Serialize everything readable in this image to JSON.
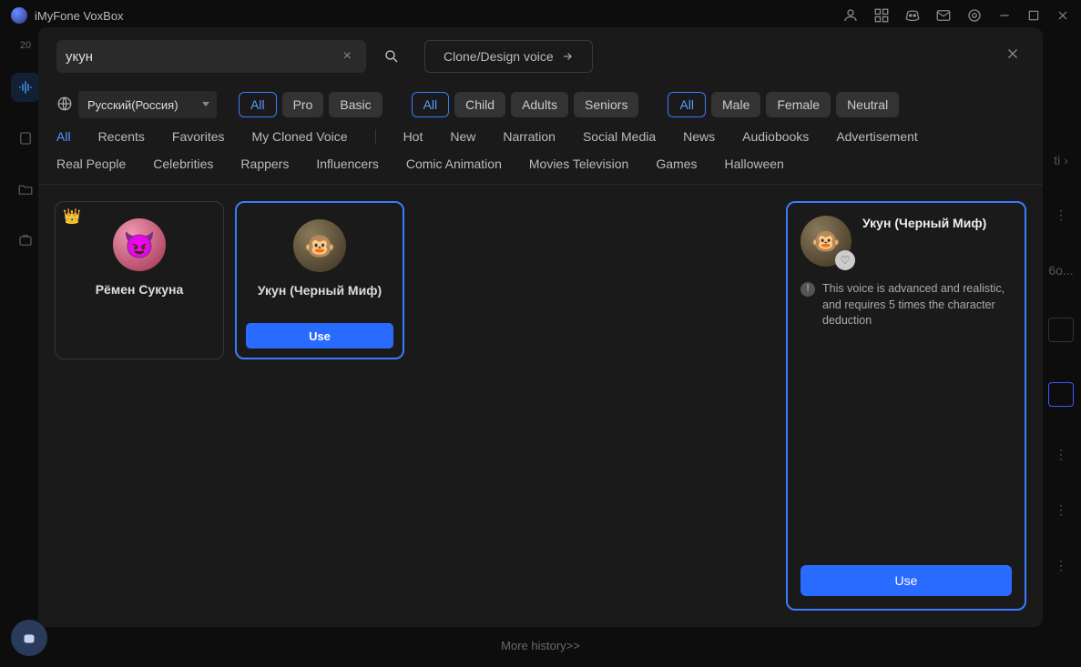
{
  "title": "iMyFone VoxBox",
  "backdrop": {
    "more_history": "More history>>",
    "rightpeek": [
      "ti ›",
      "6o...",
      "⋮",
      "⋮",
      "⋮"
    ]
  },
  "search": {
    "value": "укун",
    "clear": "×"
  },
  "clone_label": "Clone/Design voice",
  "lang": {
    "selected": "Русский(Россия)"
  },
  "filters": {
    "tier": {
      "all": "All",
      "pro": "Pro",
      "basic": "Basic"
    },
    "age": {
      "all": "All",
      "child": "Child",
      "adults": "Adults",
      "seniors": "Seniors"
    },
    "gender": {
      "all": "All",
      "male": "Male",
      "female": "Female",
      "neutral": "Neutral"
    }
  },
  "cats1": {
    "all": "All",
    "recents": "Recents",
    "favorites": "Favorites",
    "my_cloned": "My Cloned Voice",
    "hot": "Hot",
    "new": "New",
    "narration": "Narration",
    "social": "Social Media",
    "news": "News",
    "audiobooks": "Audiobooks",
    "advertisement": "Advertisement"
  },
  "cats2": {
    "real": "Real People",
    "celeb": "Celebrities",
    "rappers": "Rappers",
    "infl": "Influencers",
    "comic": "Comic Animation",
    "movies": "Movies Television",
    "games": "Games",
    "halloween": "Halloween"
  },
  "results": [
    {
      "name": "Рёмен Сукуна",
      "premium": true
    },
    {
      "name": "Укун (Черный Миф)",
      "premium": false,
      "selected": true,
      "use": "Use"
    }
  ],
  "detail": {
    "title": "Укун (Черный Миф)",
    "note": "This voice is advanced and realistic, and requires 5 times the character deduction",
    "use": "Use"
  }
}
